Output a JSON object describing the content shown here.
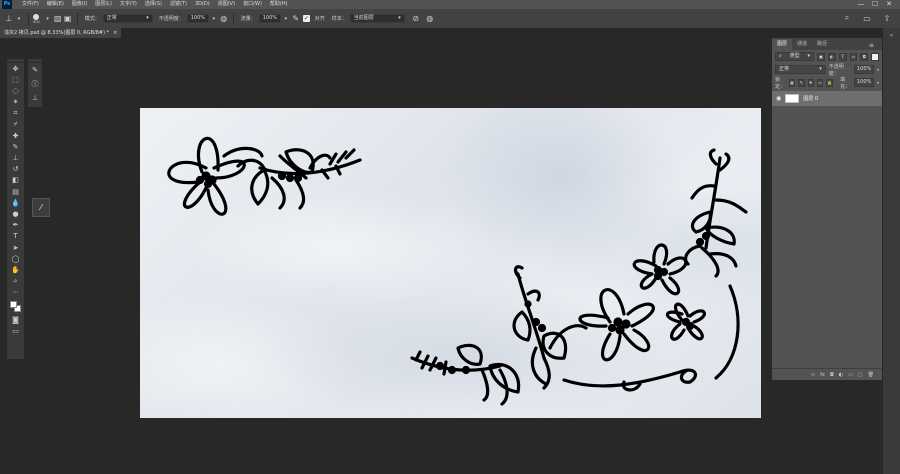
{
  "menubar": {
    "logo": "Ps",
    "items": [
      "文件(F)",
      "编辑(E)",
      "图像(I)",
      "图层(L)",
      "文字(Y)",
      "选择(S)",
      "滤镜(T)",
      "3D(D)",
      "视图(V)",
      "窗口(W)",
      "帮助(H)"
    ],
    "win": [
      "—",
      "☐",
      "✕"
    ]
  },
  "options": {
    "brush_size": "900",
    "mode_label": "模式：",
    "mode_value": "正常",
    "opacity_label": "不透明度：",
    "opacity_value": "100%",
    "flow_label": "流量：",
    "flow_value": "100%",
    "align_label": "对齐",
    "sample_label": "样本：",
    "sample_value": "当前图层"
  },
  "document": {
    "tab_title": "浅灰2 拷贝.psd @ 8.33%(图层 0, RGB/8#) *",
    "close": "×"
  },
  "panel": {
    "tabs": [
      "图层",
      "通道",
      "路径"
    ],
    "kind_label": "类型",
    "blend": "正常",
    "opacity_label": "不透明度：",
    "opacity_value": "100%",
    "lock_label": "锁定：",
    "fill_label": "填充：",
    "fill_value": "100%",
    "layer_name": "图层 0",
    "footer": [
      "∞",
      "fx",
      "◘",
      "◐",
      "▭",
      "▢",
      "🗑"
    ]
  },
  "colors": {
    "app_bg": "#282828",
    "menubar": "#535353",
    "optbar": "#424242",
    "panel": "#535353",
    "canvas_base": "#e6eaef",
    "ink": "#000000"
  },
  "icons": [
    "clone-stamp-icon",
    "brush-preset-icon",
    "move-tool-icon",
    "marquee-icon",
    "lasso-icon",
    "magic-wand-icon",
    "crop-icon",
    "eyedropper-icon",
    "healing-brush-icon",
    "brush-icon",
    "stamp-icon",
    "history-brush-icon",
    "eraser-icon",
    "gradient-icon",
    "blur-icon",
    "dodge-icon",
    "pen-icon",
    "type-icon",
    "path-select-icon",
    "shape-icon",
    "hand-icon",
    "zoom-icon",
    "more-icon"
  ]
}
